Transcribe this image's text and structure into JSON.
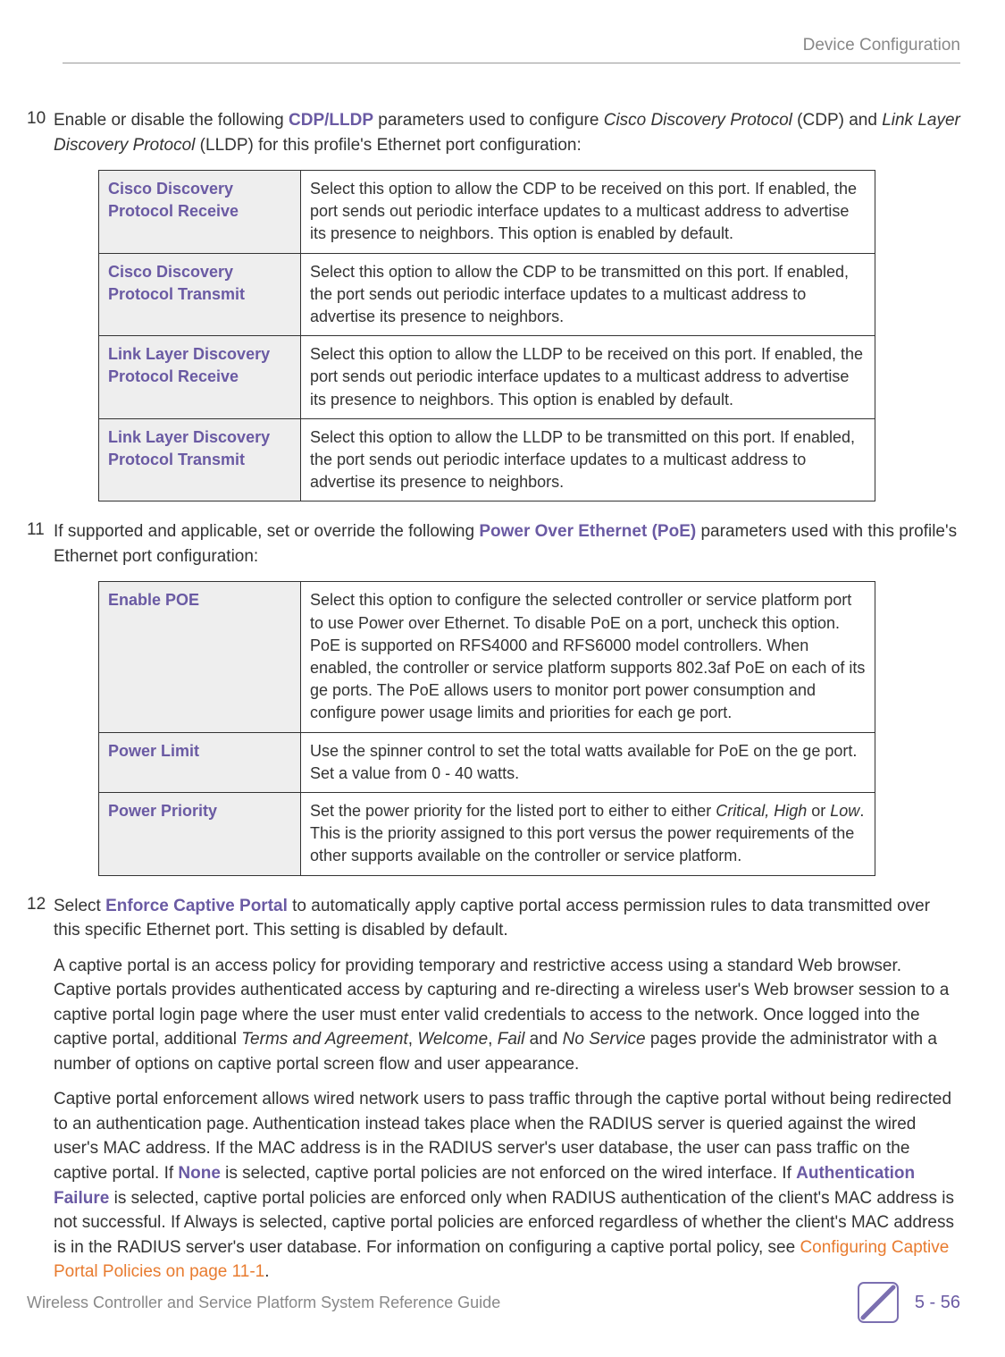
{
  "header": {
    "section": "Device Configuration"
  },
  "steps": {
    "s10": {
      "num": "10",
      "pre": "Enable or disable the following ",
      "bold1": "CDP/LLDP",
      "mid1": " parameters used to configure ",
      "it1": "Cisco Discovery Protocol",
      "mid2": " (CDP) and ",
      "it2": "Link Layer Discovery Protocol",
      "post": " (LLDP) for this profile's Ethernet port configuration:"
    },
    "s11": {
      "num": "11",
      "pre": "If supported and applicable, set or override the following ",
      "bold1": "Power Over Ethernet (PoE)",
      "post": " parameters used with this profile's Ethernet port configuration:"
    },
    "s12": {
      "num": "12",
      "pre": "Select ",
      "bold1": "Enforce Captive Portal",
      "post": " to automatically apply captive portal access permission rules to data transmitted over this specific Ethernet port. This setting is disabled by default.",
      "p2a": "A captive portal is an access policy for providing temporary and restrictive access using a standard Web browser. Captive portals provides authenticated access by capturing and re-directing a wireless user's Web browser session to a captive portal login page where the user must enter valid credentials to access to the network. Once logged into the captive portal, additional ",
      "p2_it1": "Terms and Agreement",
      "p2b": ", ",
      "p2_it2": "Welcome",
      "p2c": ", ",
      "p2_it3": "Fail",
      "p2d": " and ",
      "p2_it4": "No Service",
      "p2e": " pages provide the administrator with a number of options on captive portal screen flow and user appearance.",
      "p3a": "Captive portal enforcement allows wired network users to pass traffic through the captive portal without being redirected to an authentication page. Authentication instead takes place when the RADIUS server is queried against the wired user's MAC address. If the MAC address is in the RADIUS server's user database, the user can pass traffic on the captive portal. If ",
      "p3_b1": "None",
      "p3b": " is selected, captive portal policies are not enforced on the wired interface. If ",
      "p3_b2": "Authentication Failure",
      "p3c": " is selected, captive portal policies are enforced only when RADIUS authentication of the client's MAC address is not successful. If Always is selected, captive portal policies are enforced regardless of whether the client's MAC address is in the RADIUS server's user database. For information on configuring a captive portal policy, see ",
      "p3_link": "Configuring Captive Portal Policies on page 11-1",
      "p3d": "."
    }
  },
  "table1": [
    {
      "label": "Cisco Discovery Protocol Receive",
      "desc": "Select this option to allow the CDP to be received on this port. If enabled, the port sends out periodic interface updates to a multicast address to advertise its presence to neighbors. This option is enabled by default."
    },
    {
      "label": "Cisco Discovery Protocol Transmit",
      "desc": "Select this option to allow the CDP to be transmitted on this port. If enabled, the port sends out periodic interface updates to a multicast address to advertise its presence to neighbors."
    },
    {
      "label": "Link Layer Discovery Protocol Receive",
      "desc": "Select this option to allow the LLDP to be received on this port. If enabled, the port sends out periodic interface updates to a multicast address to advertise its presence to neighbors. This option is enabled by default."
    },
    {
      "label": "Link Layer Discovery Protocol Transmit",
      "desc": "Select this option to allow the LLDP to be transmitted on this port. If enabled, the port sends out periodic interface updates to a multicast address to advertise its presence to neighbors."
    }
  ],
  "table2": [
    {
      "label": "Enable POE",
      "desc": "Select this option to configure the selected controller or service platform port to use Power over Ethernet. To disable PoE on a port, uncheck this option. PoE is supported on RFS4000 and RFS6000 model controllers. When enabled, the controller or service platform supports 802.3af PoE on each of its ge ports. The PoE allows users to monitor port power consumption and configure power usage limits and priorities for each ge port."
    },
    {
      "label": "Power Limit",
      "desc": "Use the spinner control to set the total watts available for PoE on the ge port. Set a value from 0 - 40 watts."
    },
    {
      "label": "Power Priority",
      "desc_pre": "Set the power priority for the listed port to either to either ",
      "desc_it": "Critical, High",
      "desc_mid": " or ",
      "desc_it2": "Low",
      "desc_post": ". This is the priority assigned to this port versus the power requirements of the other supports available on the controller or service platform."
    }
  ],
  "footer": {
    "title": "Wireless Controller and Service Platform System Reference Guide",
    "pagenum": "5 - 56"
  }
}
